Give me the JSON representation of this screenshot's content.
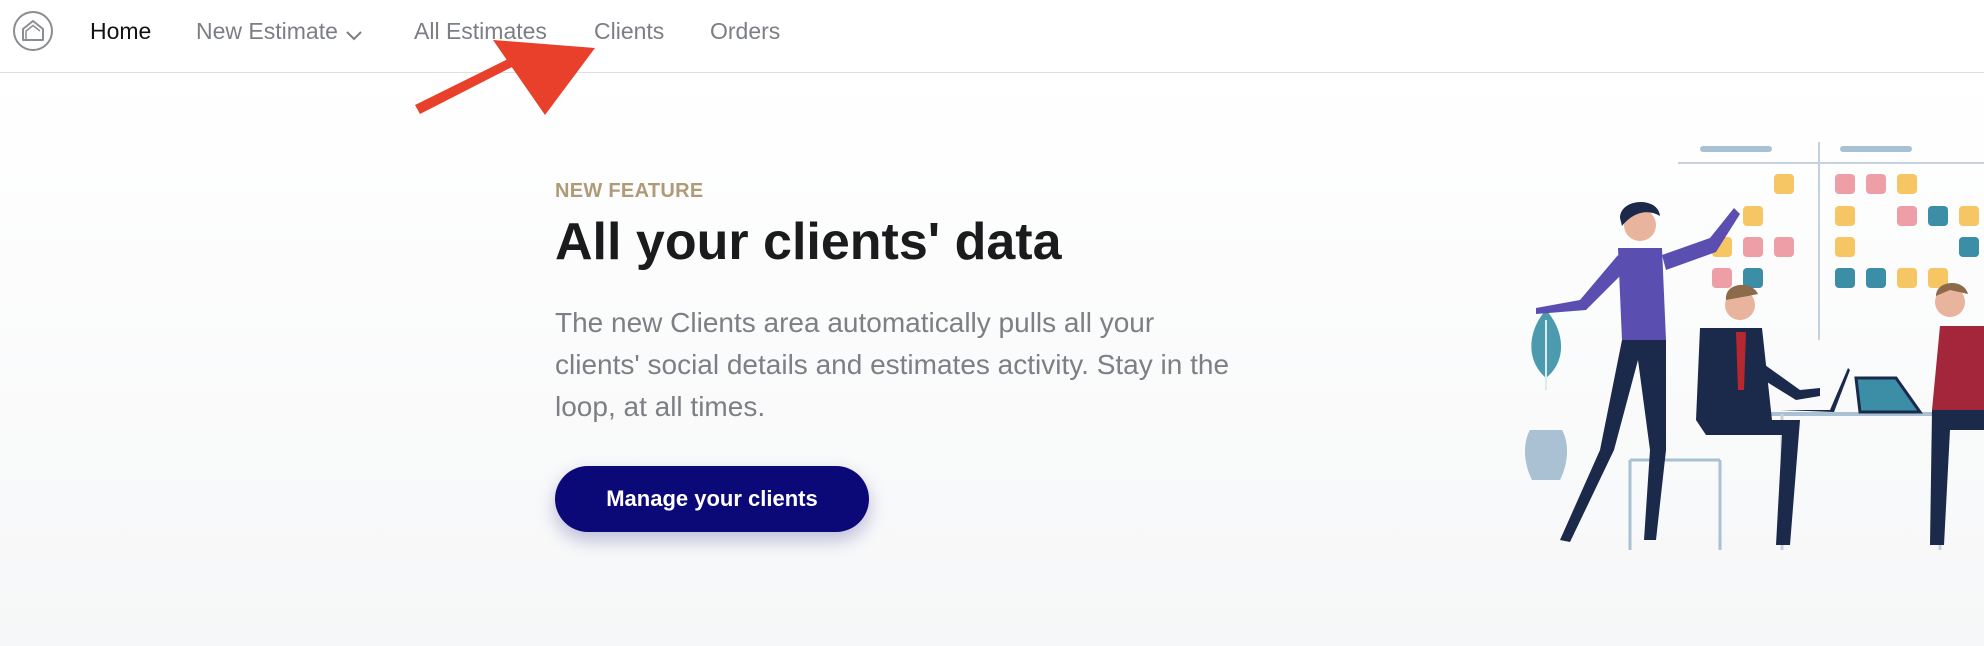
{
  "nav": {
    "home": "Home",
    "new_estimate": "New Estimate",
    "all_estimates": "All Estimates",
    "clients": "Clients",
    "orders": "Orders"
  },
  "hero": {
    "eyebrow": "NEW FEATURE",
    "headline": "All your clients' data",
    "body": "The new Clients area automatically pulls all your clients' social details and estimates activity. Stay in the loop, at all times.",
    "cta": "Manage your clients"
  },
  "icons": {
    "logo": "house-logo-icon",
    "dropdown": "chevron-down-icon",
    "annotation": "red-arrow-annotation"
  },
  "colors": {
    "primary": "#0b0878",
    "eyebrow": "#b09a78",
    "annotation": "#e8402a",
    "nav_inactive": "#7b7f84",
    "nav_active": "#111111"
  }
}
